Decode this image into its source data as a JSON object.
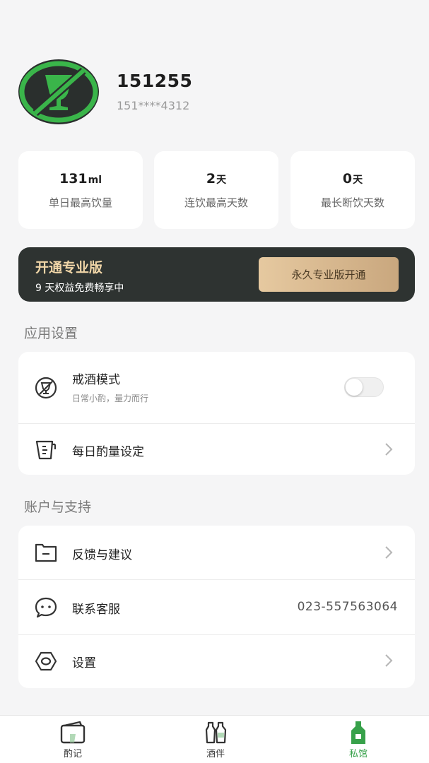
{
  "profile": {
    "avatar_icon": "no-drinking-icon",
    "username": "151255",
    "phone": "151****4312"
  },
  "stats": [
    {
      "value": "131",
      "unit": "ml",
      "label": "单日最高饮量"
    },
    {
      "value": "2",
      "unit": "天",
      "label": "连饮最高天数"
    },
    {
      "value": "0",
      "unit": "天",
      "label": "最长断饮天数"
    }
  ],
  "pro_banner": {
    "title": "开通专业版",
    "subtitle": "9 天权益免费畅享中",
    "button_label": "永久专业版开通"
  },
  "app_settings": {
    "section_title": "应用设置",
    "quit_mode": {
      "label": "戒酒模式",
      "desc": "日常小酌，量力而行",
      "enabled": false,
      "icon": "no-drinking-small-icon"
    },
    "daily_limit": {
      "label": "每日酌量设定",
      "icon": "measuring-cup-icon"
    }
  },
  "account": {
    "section_title": "账户与支持",
    "feedback": {
      "label": "反馈与建议",
      "icon": "feedback-icon"
    },
    "contact": {
      "label": "联系客服",
      "value": "023-557563064",
      "icon": "chat-bubble-icon"
    },
    "settings": {
      "label": "设置",
      "icon": "settings-eye-icon"
    }
  },
  "tabbar": [
    {
      "label": "酌记",
      "icon": "notebook-icon",
      "active": false
    },
    {
      "label": "酒伴",
      "icon": "bottles-icon",
      "active": false
    },
    {
      "label": "私馆",
      "icon": "bottle-icon",
      "active": true
    }
  ],
  "colors": {
    "accent_green": "#37a14a",
    "banner_bg": "#2e3331",
    "banner_title": "#f1d6a8",
    "banner_button": "#d8b98f"
  }
}
